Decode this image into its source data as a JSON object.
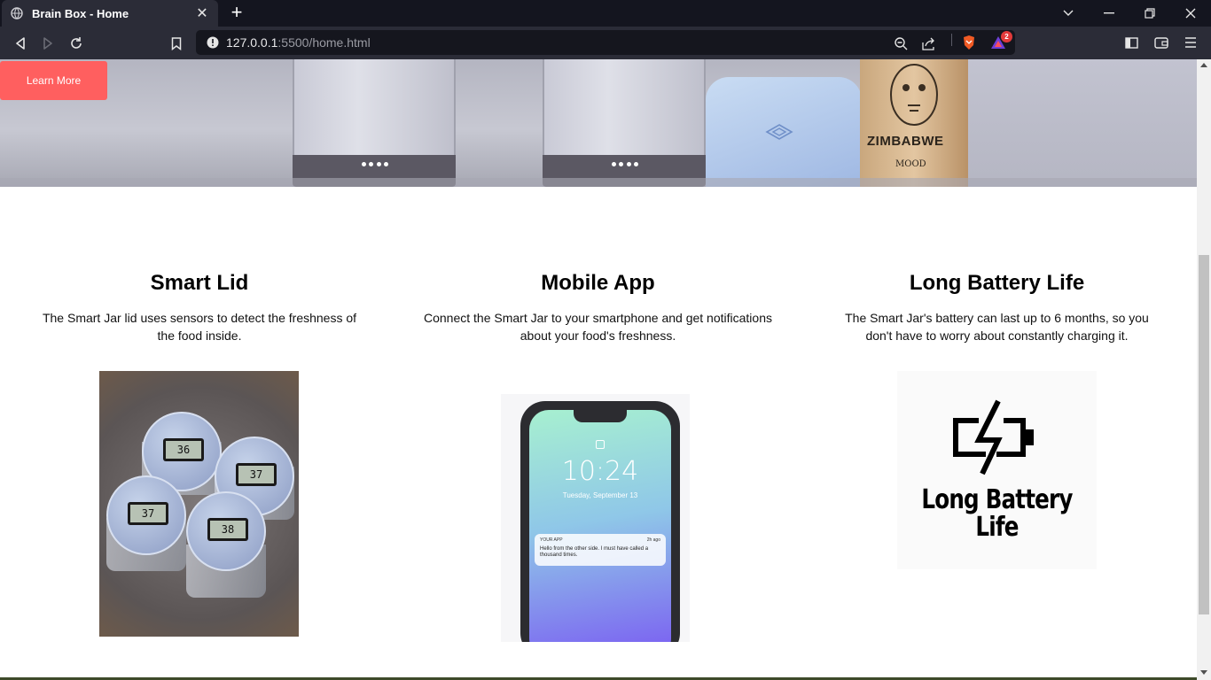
{
  "browser": {
    "tab_title": "Brain Box - Home",
    "url_host": "127.0.0.1",
    "url_rest": ":5500/home.html",
    "rewards_count": "2",
    "icons": [
      "globe-icon",
      "close-icon",
      "plus-icon",
      "chevron-down-icon",
      "minimize-icon",
      "restore-icon",
      "close-window-icon",
      "back-icon",
      "forward-icon",
      "reload-icon",
      "bookmark-icon",
      "info-icon",
      "zoom-icon",
      "share-icon",
      "brave-shield-icon",
      "brave-rewards-icon",
      "sidebar-icon",
      "wallet-icon",
      "menu-icon"
    ]
  },
  "hero": {
    "button_label": "Learn More",
    "bag_brand": "ZIMBABWE",
    "bag_sub": "MOOD",
    "accent": "#ff5f5f"
  },
  "features": [
    {
      "title": "Smart Lid",
      "text": "The Smart Jar lid uses sensors to detect the freshness of the food inside."
    },
    {
      "title": "Mobile App",
      "text": "Connect the Smart Jar to your smartphone and get notifications about your food's freshness."
    },
    {
      "title": "Long Battery Life",
      "text": "The Smart Jar's battery can last up to 6 months, so you don't have to worry about constantly charging it."
    }
  ],
  "images": {
    "jars_readings": [
      "36",
      "37",
      "37",
      "38"
    ],
    "phone_time": "10:24",
    "phone_date": "Tuesday, September 13",
    "notif_app": "YOUR APP",
    "notif_ago": "2h ago",
    "notif_msg": "Hello from the other side. I must have called a thousand times.",
    "battery_caption_1": "Long Battery",
    "battery_caption_2": "Life"
  }
}
